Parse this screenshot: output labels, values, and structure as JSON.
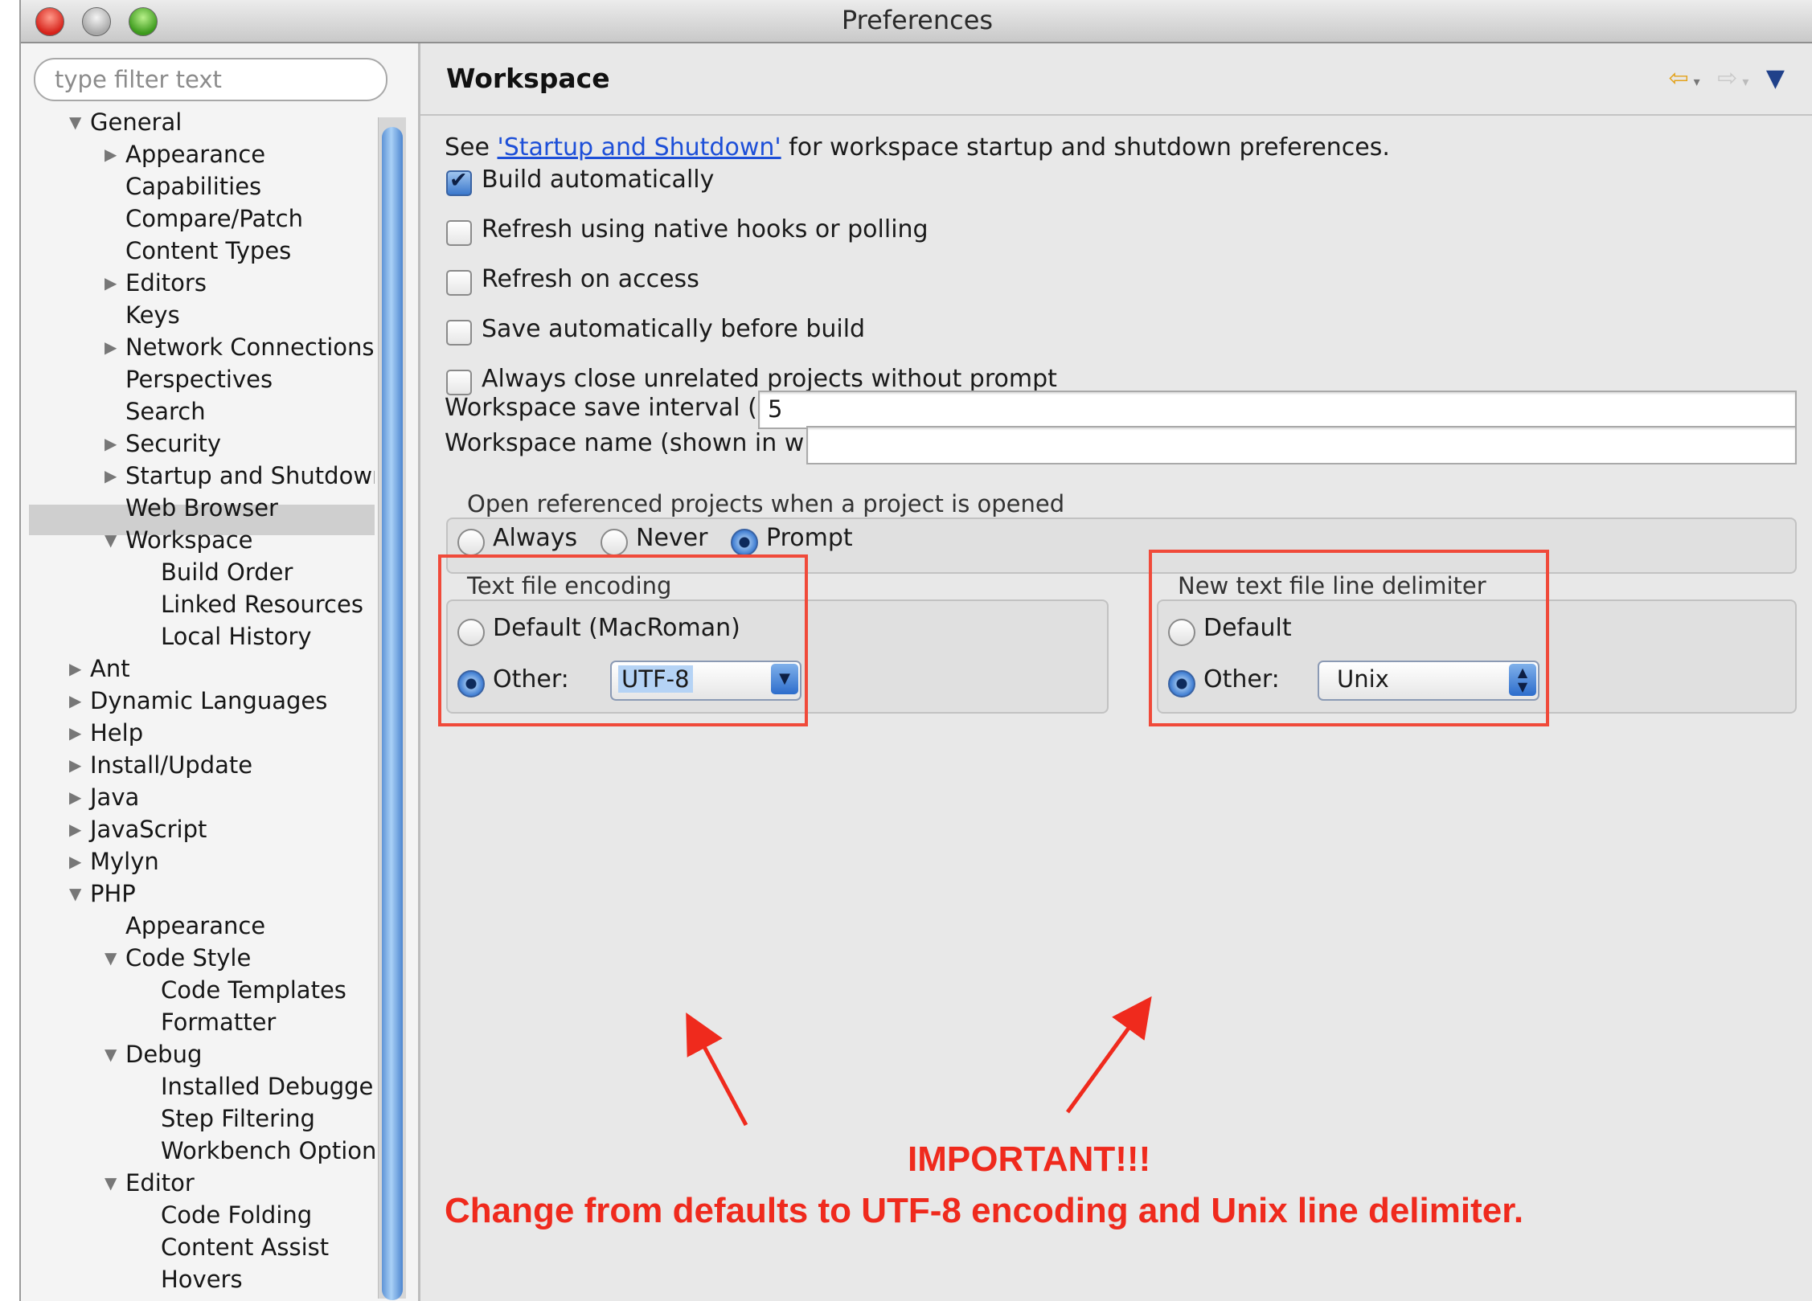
{
  "window": {
    "title": "Preferences"
  },
  "filter": {
    "placeholder": "type filter text"
  },
  "tree": [
    {
      "label": "General",
      "level": 0,
      "arrow": "down"
    },
    {
      "label": "Appearance",
      "level": 1,
      "arrow": "right"
    },
    {
      "label": "Capabilities",
      "level": 1,
      "arrow": ""
    },
    {
      "label": "Compare/Patch",
      "level": 1,
      "arrow": ""
    },
    {
      "label": "Content Types",
      "level": 1,
      "arrow": ""
    },
    {
      "label": "Editors",
      "level": 1,
      "arrow": "right"
    },
    {
      "label": "Keys",
      "level": 1,
      "arrow": ""
    },
    {
      "label": "Network Connections",
      "level": 1,
      "arrow": "right"
    },
    {
      "label": "Perspectives",
      "level": 1,
      "arrow": ""
    },
    {
      "label": "Search",
      "level": 1,
      "arrow": ""
    },
    {
      "label": "Security",
      "level": 1,
      "arrow": "right"
    },
    {
      "label": "Startup and Shutdown",
      "level": 1,
      "arrow": "right"
    },
    {
      "label": "Web Browser",
      "level": 1,
      "arrow": ""
    },
    {
      "label": "Workspace",
      "level": 1,
      "arrow": "down",
      "selected": true
    },
    {
      "label": "Build Order",
      "level": 2,
      "arrow": ""
    },
    {
      "label": "Linked Resources",
      "level": 2,
      "arrow": ""
    },
    {
      "label": "Local History",
      "level": 2,
      "arrow": ""
    },
    {
      "label": "Ant",
      "level": 0,
      "arrow": "right"
    },
    {
      "label": "Dynamic Languages",
      "level": 0,
      "arrow": "right"
    },
    {
      "label": "Help",
      "level": 0,
      "arrow": "right"
    },
    {
      "label": "Install/Update",
      "level": 0,
      "arrow": "right"
    },
    {
      "label": "Java",
      "level": 0,
      "arrow": "right"
    },
    {
      "label": "JavaScript",
      "level": 0,
      "arrow": "right"
    },
    {
      "label": "Mylyn",
      "level": 0,
      "arrow": "right"
    },
    {
      "label": "PHP",
      "level": 0,
      "arrow": "down"
    },
    {
      "label": "Appearance",
      "level": 1,
      "arrow": ""
    },
    {
      "label": "Code Style",
      "level": 1,
      "arrow": "down"
    },
    {
      "label": "Code Templates",
      "level": 2,
      "arrow": ""
    },
    {
      "label": "Formatter",
      "level": 2,
      "arrow": ""
    },
    {
      "label": "Debug",
      "level": 1,
      "arrow": "down"
    },
    {
      "label": "Installed Debugger",
      "level": 2,
      "arrow": ""
    },
    {
      "label": "Step Filtering",
      "level": 2,
      "arrow": ""
    },
    {
      "label": "Workbench Option:",
      "level": 2,
      "arrow": ""
    },
    {
      "label": "Editor",
      "level": 1,
      "arrow": "down"
    },
    {
      "label": "Code Folding",
      "level": 2,
      "arrow": ""
    },
    {
      "label": "Content Assist",
      "level": 2,
      "arrow": ""
    },
    {
      "label": "Hovers",
      "level": 2,
      "arrow": ""
    }
  ],
  "page": {
    "title": "Workspace",
    "see_prefix": "See ",
    "see_link": "'Startup and Shutdown'",
    "see_suffix": " for workspace startup and shutdown preferences.",
    "checkboxes": [
      {
        "label": "Build automatically",
        "checked": true
      },
      {
        "label": "Refresh using native hooks or polling",
        "checked": false
      },
      {
        "label": "Refresh on access",
        "checked": false
      },
      {
        "label": "Save automatically before build",
        "checked": false
      },
      {
        "label": "Always close unrelated projects without prompt",
        "checked": false
      }
    ],
    "save_interval_label": "Workspace save interval (in minutes):",
    "save_interval_value": "5",
    "workspace_name_label": "Workspace name (shown in window title):",
    "workspace_name_value": "",
    "open_ref": {
      "title": "Open referenced projects when a project is opened",
      "options": [
        "Always",
        "Never",
        "Prompt"
      ],
      "selected": "Prompt"
    },
    "encoding": {
      "title": "Text file encoding",
      "default_label": "Default (MacRoman)",
      "other_label": "Other:",
      "other_value": "UTF-8",
      "selected": "other"
    },
    "delimiter": {
      "title": "New text file line delimiter",
      "default_label": "Default",
      "other_label": "Other:",
      "other_value": "Unix",
      "selected": "other"
    }
  },
  "annotation": {
    "heading": "IMPORTANT!!!",
    "text": "Change from defaults to UTF-8 encoding and Unix line delimiter.",
    "color": "#ef2a1d"
  }
}
